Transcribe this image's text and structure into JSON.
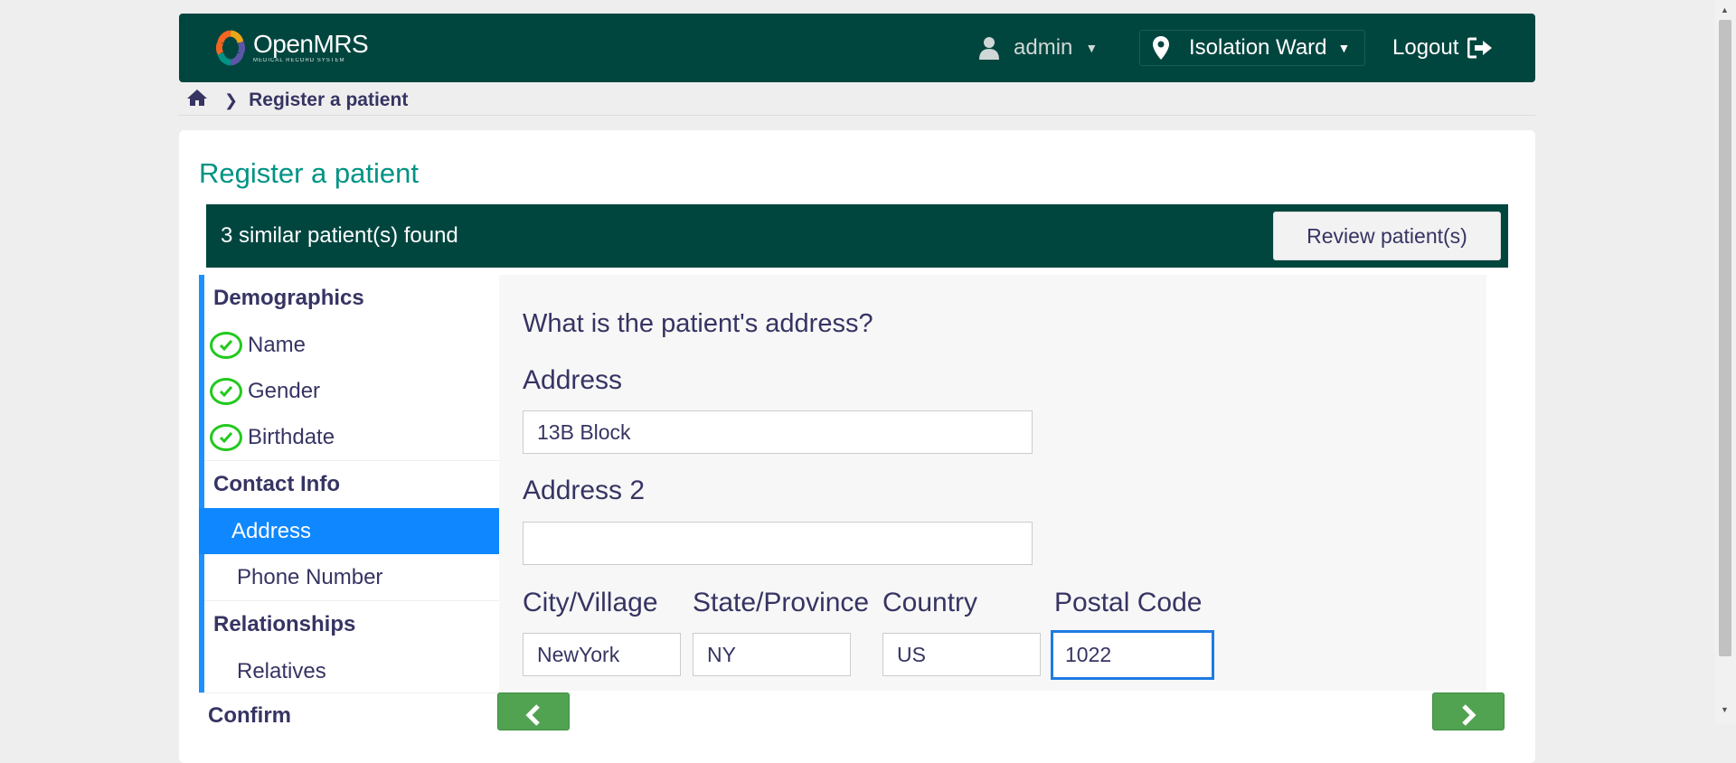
{
  "header": {
    "logo_name": "OpenMRS",
    "logo_tagline": "MEDICAL RECORD SYSTEM",
    "user": "admin",
    "location": "Isolation Ward",
    "logout": "Logout"
  },
  "breadcrumb": {
    "current": "Register a patient"
  },
  "page": {
    "title": "Register a patient"
  },
  "similar": {
    "message": "3 similar patient(s) found",
    "review_button": "Review patient(s)"
  },
  "sidebar": {
    "demographics": {
      "title": "Demographics",
      "items": [
        "Name",
        "Gender",
        "Birthdate"
      ]
    },
    "contact": {
      "title": "Contact Info",
      "items": [
        "Address",
        "Phone Number"
      ]
    },
    "relationships": {
      "title": "Relationships",
      "items": [
        "Relatives"
      ]
    },
    "confirm": "Confirm"
  },
  "form": {
    "question": "What is the patient's address?",
    "address_label": "Address",
    "address_value": "13B Block",
    "address2_label": "Address 2",
    "address2_value": "",
    "city_label": "City/Village",
    "city_value": "NewYork",
    "state_label": "State/Province",
    "state_value": "NY",
    "country_label": "Country",
    "country_value": "US",
    "postal_label": "Postal Code",
    "postal_value": "1022"
  },
  "colors": {
    "header_bg": "#00463f",
    "title_teal": "#009384",
    "active_blue": "#0f87ff",
    "check_green": "#22c91d",
    "nav_green": "#51a351"
  }
}
